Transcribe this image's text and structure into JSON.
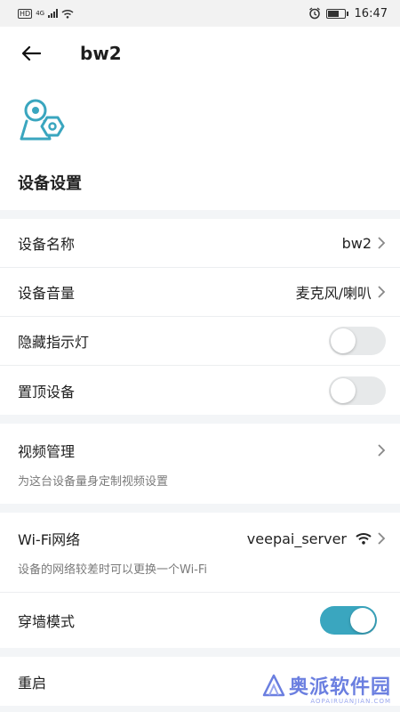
{
  "status_bar": {
    "time": "16:47",
    "hd": "HD",
    "network": "4G"
  },
  "header": {
    "title": "bw2"
  },
  "hero": {
    "section_title": "设备设置"
  },
  "group1": {
    "device_name_label": "设备名称",
    "device_name_value": "bw2",
    "volume_label": "设备音量",
    "volume_value": "麦克风/喇叭",
    "hide_led_label": "隐藏指示灯",
    "hide_led_on": false,
    "pin_label": "置顶设备",
    "pin_on": false
  },
  "group2": {
    "video_label": "视频管理",
    "video_desc": "为这台设备量身定制视频设置"
  },
  "group3": {
    "wifi_label": "Wi-Fi网络",
    "wifi_value": "veepai_server",
    "wifi_desc": "设备的网络较差时可以更换一个Wi-Fi",
    "wall_label": "穿墙模式",
    "wall_on": true
  },
  "group4": {
    "restart_label": "重启"
  },
  "watermark": {
    "text": "奥派软件园",
    "sub": "AOPAIRUANJIAN.COM"
  },
  "colors": {
    "accent": "#3aa6bf",
    "toggle_off": "#e7e9ea",
    "watermark": "#6b7fe0"
  }
}
